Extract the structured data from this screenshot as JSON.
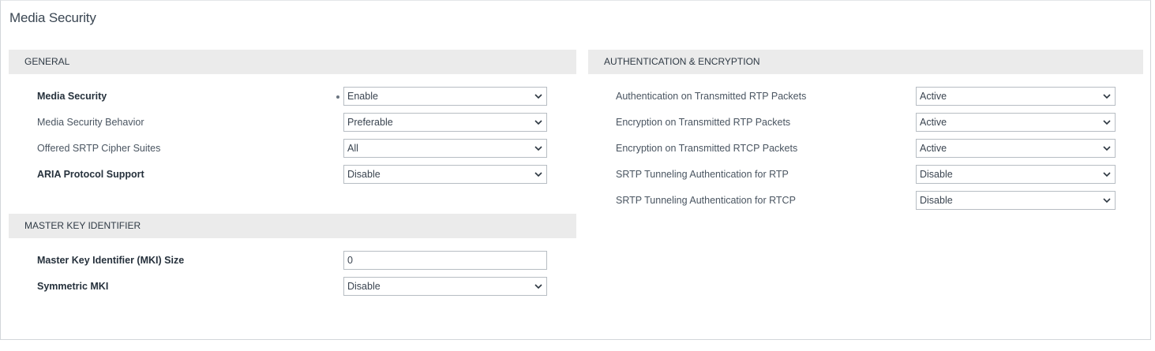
{
  "page": {
    "title": "Media Security"
  },
  "general": {
    "header": "GENERAL",
    "rows": [
      {
        "label": "Media Security",
        "value": "Enable"
      },
      {
        "label": "Media Security Behavior",
        "value": "Preferable"
      },
      {
        "label": "Offered SRTP Cipher Suites",
        "value": "All"
      },
      {
        "label": "ARIA Protocol Support",
        "value": "Disable"
      }
    ]
  },
  "mki": {
    "header": "MASTER KEY IDENTIFIER",
    "size_label": "Master Key Identifier (MKI) Size",
    "size_value": "0",
    "symmetric_label": "Symmetric MKI",
    "symmetric_value": "Disable"
  },
  "auth": {
    "header": "AUTHENTICATION & ENCRYPTION",
    "rows": [
      {
        "label": "Authentication on Transmitted RTP Packets",
        "value": "Active"
      },
      {
        "label": "Encryption on Transmitted RTP Packets",
        "value": "Active"
      },
      {
        "label": "Encryption on Transmitted RTCP Packets",
        "value": "Active"
      },
      {
        "label": "SRTP Tunneling Authentication for RTP",
        "value": "Disable"
      },
      {
        "label": "SRTP Tunneling Authentication for RTCP",
        "value": "Disable"
      }
    ]
  },
  "icons": {
    "dropdown": "chevron-down-icon",
    "modified_marker": "modified-dot-icon"
  }
}
